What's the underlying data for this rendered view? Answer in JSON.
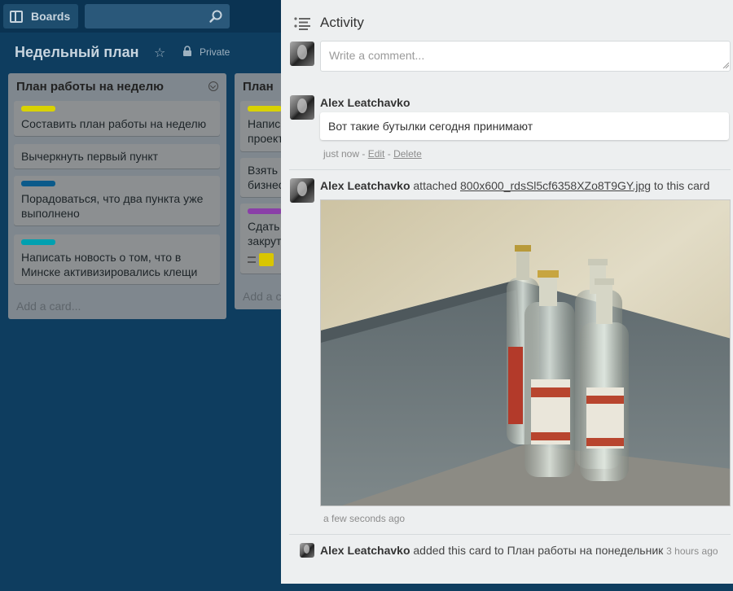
{
  "topbar": {
    "boards_label": "Boards",
    "search_placeholder": ""
  },
  "board": {
    "title": "Недельный план",
    "visibility": "Private"
  },
  "lists": [
    {
      "title": "План работы на неделю",
      "cards": [
        {
          "label_color": "#d9d200",
          "text": "Составить план работы на неделю"
        },
        {
          "label_color": "",
          "text": "Вычеркнуть первый пункт"
        },
        {
          "label_color": "#0b5a8a",
          "text": "Порадоваться, что два пункта уже выполнено"
        },
        {
          "label_color": "#00a0b0",
          "text": "Написать новость о том, что в Минске активизировались клещи"
        }
      ],
      "add_card": "Add a card..."
    },
    {
      "title": "План",
      "cards": [
        {
          "label_color": "#d9d200",
          "text": "Напис проект"
        },
        {
          "label_color": "",
          "text": "Взять бизнес"
        },
        {
          "label_color": "#8a3fa8",
          "text": "Сдать закрут"
        }
      ],
      "add_card": "Add a c"
    }
  ],
  "activity": {
    "title": "Activity",
    "comment_placeholder": "Write a comment...",
    "items": [
      {
        "author": "Alex Leatchavko",
        "comment": "Вот такие бутылки сегодня принимают",
        "time": "just now",
        "sep1": " - ",
        "edit": "Edit",
        "sep2": " - ",
        "delete": "Delete"
      },
      {
        "author": "Alex Leatchavko",
        "verb": "attached",
        "file": "800x600_rdsSl5cf6358XZo8T9GY.jpg",
        "suffix": "to this card",
        "time": "a few seconds ago"
      },
      {
        "author": "Alex Leatchavko",
        "text": "added this card to План работы на понедельник",
        "time": "3 hours ago"
      }
    ]
  },
  "colors": {
    "board_bg": "#0e3d5f",
    "panel_bg": "#edeff0"
  }
}
